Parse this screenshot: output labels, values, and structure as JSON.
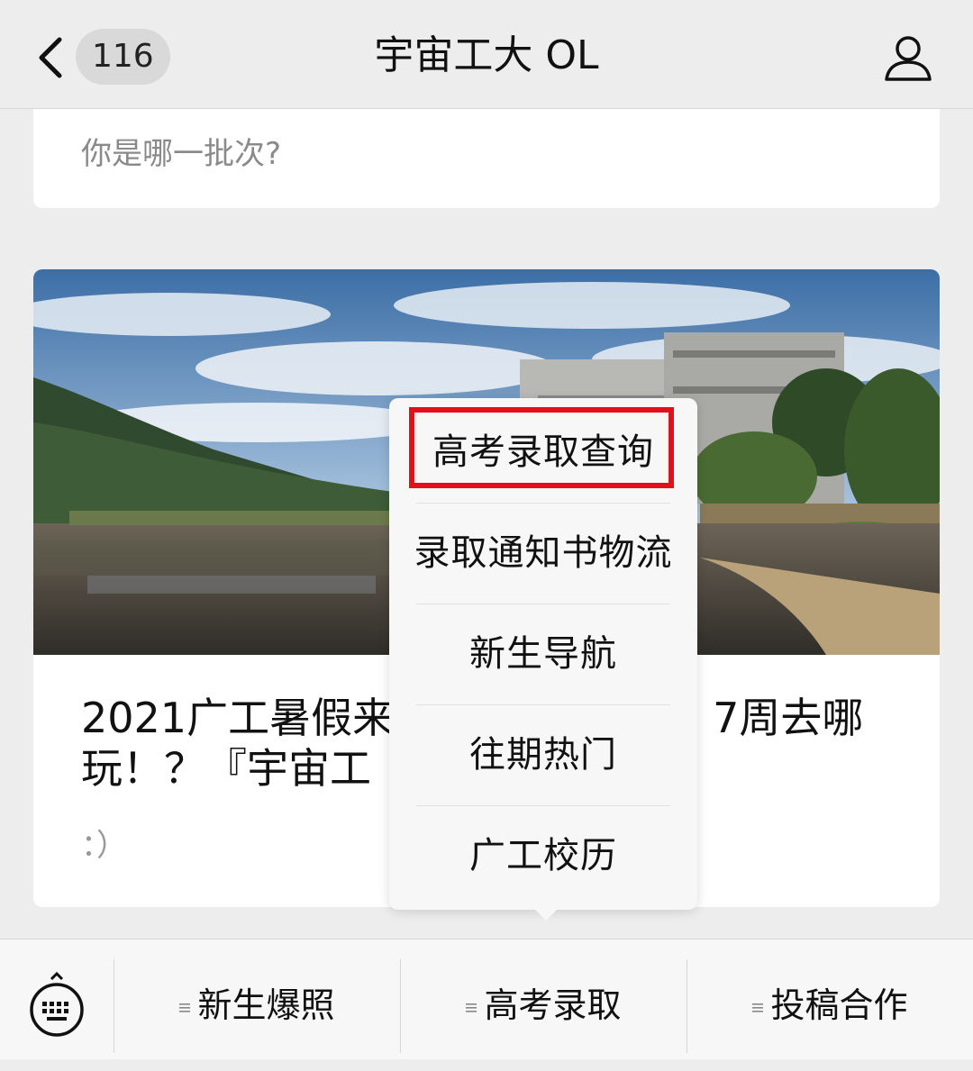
{
  "header": {
    "back_count": "116",
    "title": "宇宙工大 OL"
  },
  "card1": {
    "text": "你是哪一批次?"
  },
  "card2": {
    "title": "2021广工暑假来了！？7周去哪玩！？『宇宙工大』",
    "title_line1_visible": "2021广工暑假来",
    "title_line1_right": "7周去哪",
    "title_line2_visible": "玩！？『宇宙工",
    "subtitle": "：）"
  },
  "popup_menu": {
    "items": [
      {
        "label": "高考录取查询"
      },
      {
        "label": "录取通知书物流"
      },
      {
        "label": "新生导航"
      },
      {
        "label": "往期热门"
      },
      {
        "label": "广工校历"
      }
    ],
    "highlighted_index": 0,
    "highlight_color": "#e3101a"
  },
  "bottom_menu": {
    "buttons": [
      {
        "label": "新生爆照"
      },
      {
        "label": "高考录取"
      },
      {
        "label": "投稿合作"
      }
    ]
  },
  "icons": [
    "chevron-left-icon",
    "profile-icon",
    "keyboard-icon",
    "menu-lines-icon"
  ]
}
